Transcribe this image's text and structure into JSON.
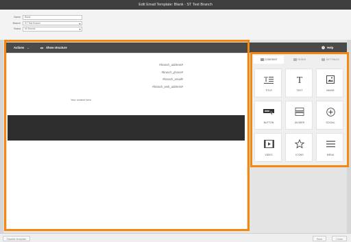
{
  "window": {
    "title": "Edit Email Template: Blank - ST Test Branch"
  },
  "form": {
    "name_label": "Name",
    "name_value": "Blank",
    "branch_label": "Branch",
    "branch_value": "ST Test Branch",
    "brand_label": "Brand",
    "brand_value": "All Brands"
  },
  "toolbar": {
    "actions_label": "Actions",
    "show_structure_label": "Show structure",
    "help_label": "Help"
  },
  "template": {
    "lines": [
      "#branch_address#",
      "#branch_phone#",
      "#branch_email#",
      "#branch_web_address#"
    ],
    "content_text": "Your content here."
  },
  "sidebar": {
    "tabs": [
      {
        "label": "CONTENT",
        "active": true
      },
      {
        "label": "ROWS",
        "active": false
      },
      {
        "label": "SETTINGS",
        "active": false
      }
    ],
    "blocks": [
      {
        "label": "TITLE",
        "icon": "title-icon"
      },
      {
        "label": "TEXT",
        "icon": "text-icon"
      },
      {
        "label": "IMAGE",
        "icon": "image-icon"
      },
      {
        "label": "BUTTON",
        "icon": "button-icon"
      },
      {
        "label": "DIVIDER",
        "icon": "divider-icon"
      },
      {
        "label": "SOCIAL",
        "icon": "social-icon"
      },
      {
        "label": "VIDEO",
        "icon": "video-icon"
      },
      {
        "label": "ICONS",
        "icon": "star-icon"
      },
      {
        "label": "MENU",
        "icon": "menu-icon"
      }
    ]
  },
  "footer": {
    "left_label": "Disable template",
    "save_label": "Save",
    "close_label": "Close"
  },
  "colors": {
    "highlight": "#f4880f",
    "toolbar": "#4a4a4a",
    "titlebar": "#3f3f3f"
  }
}
